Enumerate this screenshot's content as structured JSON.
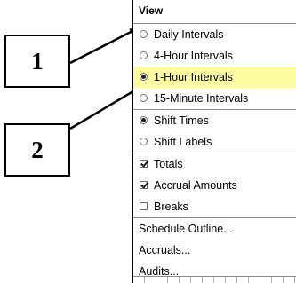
{
  "callouts": {
    "one": "1",
    "two": "2"
  },
  "menu": {
    "title": "View",
    "interval_group": [
      {
        "label": "Daily Intervals",
        "selected": false
      },
      {
        "label": "4-Hour Intervals",
        "selected": false
      },
      {
        "label": "1-Hour Intervals",
        "selected": true
      },
      {
        "label": "15-Minute Intervals",
        "selected": false
      }
    ],
    "shift_group": [
      {
        "label": "Shift Times",
        "selected": true
      },
      {
        "label": "Shift Labels",
        "selected": false
      }
    ],
    "check_group": [
      {
        "label": "Totals",
        "checked": true
      },
      {
        "label": "Accrual Amounts",
        "checked": true
      },
      {
        "label": "Breaks",
        "checked": false
      }
    ],
    "action_group": [
      {
        "label": "Schedule Outline..."
      },
      {
        "label": "Accruals..."
      },
      {
        "label": "Audits..."
      }
    ]
  },
  "colors": {
    "highlight": "#fdfda0",
    "border": "#000000"
  }
}
